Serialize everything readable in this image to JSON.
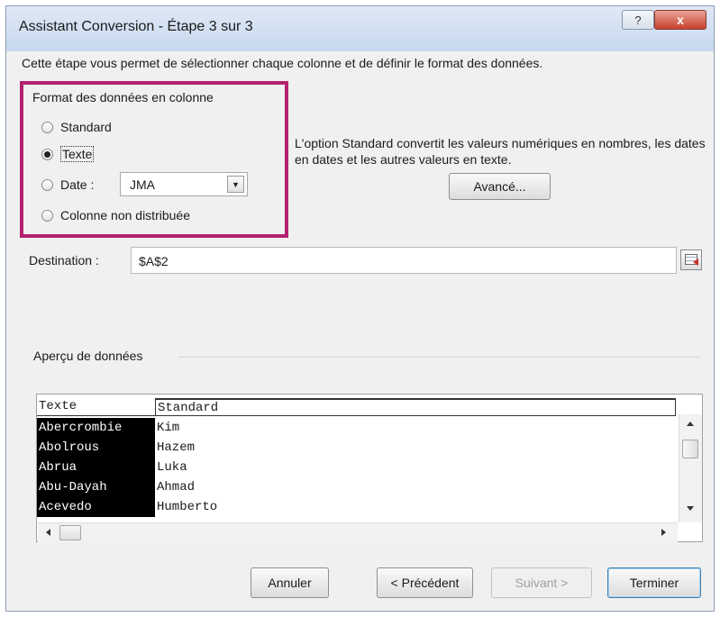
{
  "window": {
    "title": "Assistant Conversion - Étape 3 sur 3",
    "help_label": "?",
    "close_label": "x"
  },
  "intro": "Cette étape vous permet de sélectionner chaque colonne et de définir le format des données.",
  "format": {
    "legend": "Format des données en colonne",
    "options": [
      {
        "label": "Standard",
        "checked": false
      },
      {
        "label": "Texte",
        "checked": true
      },
      {
        "label": "Date :",
        "checked": false
      },
      {
        "label": "Colonne non distribuée",
        "checked": false
      }
    ],
    "date_format": "JMA",
    "description": "L'option Standard convertit les valeurs numériques en nombres, les dates en dates et les autres valeurs en texte.",
    "advanced_label": "Avancé..."
  },
  "destination": {
    "label": "Destination :",
    "value": "$A$2"
  },
  "preview": {
    "label": "Aperçu de données",
    "headers": [
      "Texte",
      "Standard"
    ],
    "rows": [
      [
        "Abercrombie",
        "Kim"
      ],
      [
        "Abolrous",
        "Hazem"
      ],
      [
        "Abrua",
        "Luka"
      ],
      [
        "Abu-Dayah",
        "Ahmad"
      ],
      [
        "Acevedo",
        "Humberto"
      ]
    ]
  },
  "buttons": {
    "cancel": "Annuler",
    "previous": "< Précédent",
    "next": "Suivant >",
    "finish": "Terminer"
  },
  "colors": {
    "highlight_border": "#b3226e",
    "close_button": "#c7402c",
    "selected_column_bg": "#000000"
  },
  "icons": {
    "collapse": "collapse-dialog-icon",
    "help": "help-icon",
    "close": "close-icon"
  }
}
